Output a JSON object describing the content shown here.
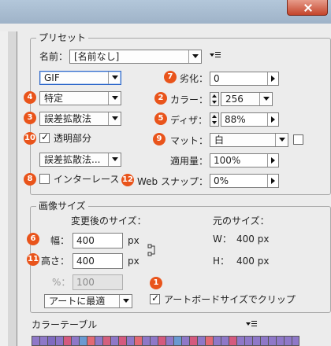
{
  "preset": {
    "title": "プリセット",
    "name_label": "名前：",
    "name_value": "[名前なし]"
  },
  "settings": {
    "format": "GIF",
    "reduction": "特定",
    "dither_method": "誤差拡散法",
    "transparency_label": "透明部分",
    "transparency_checked": true,
    "transparency_dither": "誤差拡散法...",
    "interlace_label": "インターレース",
    "interlace_checked": false,
    "lossy_label": "劣化：",
    "lossy_value": "0",
    "colors_label": "カラー：",
    "colors_value": "256",
    "dither_label": "ディザ：",
    "dither_value": "88%",
    "matte_label": "マット：",
    "matte_value": "白",
    "amount_label": "適用量：",
    "amount_value": "100%",
    "websnap_label": "Web スナップ：",
    "websnap_value": "0%"
  },
  "image_size": {
    "title": "画像サイズ",
    "new_size_label": "変更後のサイズ：",
    "original_size_label": "元のサイズ：",
    "width_label": "幅：",
    "width_value": "400",
    "height_label": "高さ：",
    "height_value": "400",
    "unit": "px",
    "percent_label": "%：",
    "percent_value": "100",
    "orig_w_label": "W：",
    "orig_w_value": "400 px",
    "orig_h_label": "H：",
    "orig_h_value": "400 px",
    "art_optimize": "アートに最適",
    "clip_label": "アートボードサイズでクリップ",
    "clip_checked": true
  },
  "color_table": {
    "title": "カラーテーブル",
    "colors": [
      "#8e78c8",
      "#8e78c8",
      "#7f6bc0",
      "#8a74c6",
      "#d45a7e",
      "#8e78c8",
      "#6a9ad1",
      "#e26a74",
      "#8e78c8",
      "#d4607e",
      "#8e78c8",
      "#d45a7e",
      "#8e78c8",
      "#e26a74",
      "#8e78c8",
      "#8e78c8",
      "#d45a7e",
      "#8e78c8",
      "#6a9ad1",
      "#8e78c8",
      "#d45a7e",
      "#8e78c8",
      "#e26a74",
      "#8e78c8",
      "#8e78c8",
      "#d45a7e",
      "#8e78c8",
      "#8e78c8",
      "#8e78c8",
      "#8e78c8",
      "#8e78c8",
      "#8e78c8",
      "#8e78c8",
      "#8e78c8"
    ]
  },
  "badges": {
    "b1": "1",
    "b2": "2",
    "b3": "3",
    "b4": "4",
    "b5": "5",
    "b6": "6",
    "b7": "7",
    "b8": "8",
    "b9": "9",
    "b10": "10",
    "b11": "11",
    "b12": "12"
  },
  "colors": {
    "badge": "#e9541b",
    "focus_border": "#2d66c9",
    "close_button": "#c4452b"
  }
}
